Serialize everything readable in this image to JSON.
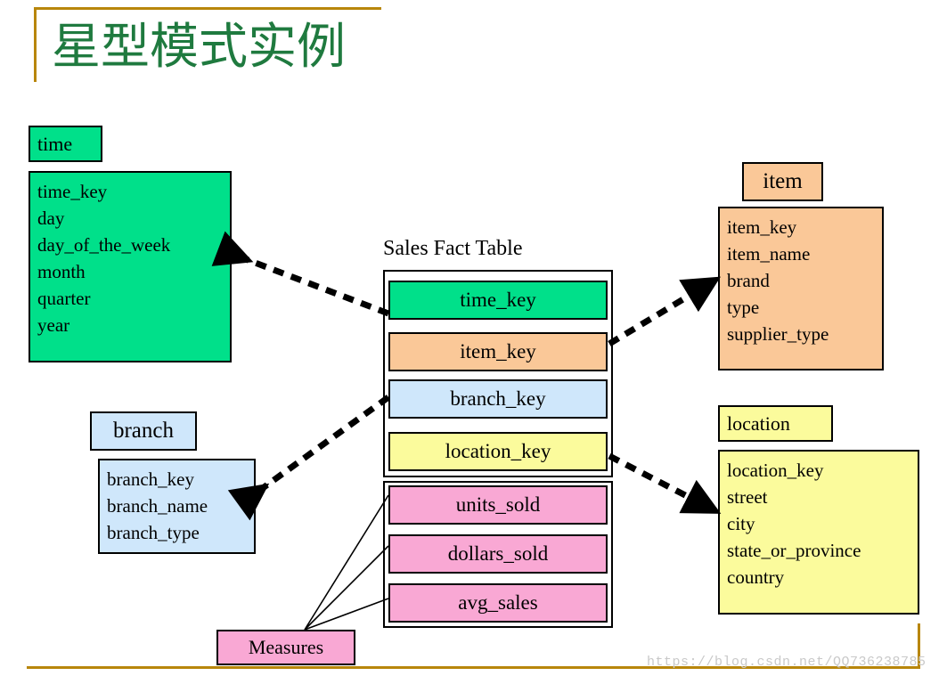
{
  "page": {
    "title": "星型模式实例",
    "title_color": "#1f7a3f",
    "rule_color": "#b8860b",
    "watermark": "https://blog.csdn.net/QQ736238785"
  },
  "fact_table": {
    "caption": "Sales Fact Table",
    "rows": [
      {
        "label": "time_key",
        "color": "#00e08a"
      },
      {
        "label": "item_key",
        "color": "#fac898"
      },
      {
        "label": "branch_key",
        "color": "#cfe7fb"
      },
      {
        "label": "location_key",
        "color": "#fbfb9c"
      },
      {
        "label": "units_sold",
        "color": "#f9a8d4"
      },
      {
        "label": "dollars_sold",
        "color": "#f9a8d4"
      },
      {
        "label": "avg_sales",
        "color": "#f9a8d4"
      }
    ],
    "measures_label": "Measures",
    "measures_color": "#f9a8d4"
  },
  "dimensions": {
    "time": {
      "name": "time",
      "color": "#00e08a",
      "fields": [
        "time_key",
        "day",
        "day_of_the_week",
        "month",
        "quarter",
        "year"
      ]
    },
    "item": {
      "name": "item",
      "color": "#fac898",
      "fields": [
        "item_key",
        "item_name",
        "brand",
        "type",
        "supplier_type"
      ]
    },
    "branch": {
      "name": "branch",
      "color": "#cfe7fb",
      "fields": [
        "branch_key",
        "branch_name",
        "branch_type"
      ]
    },
    "location": {
      "name": "location",
      "color": "#fbfb9c",
      "fields": [
        "location_key",
        "street",
        "city",
        "state_or_province",
        "country"
      ]
    }
  }
}
